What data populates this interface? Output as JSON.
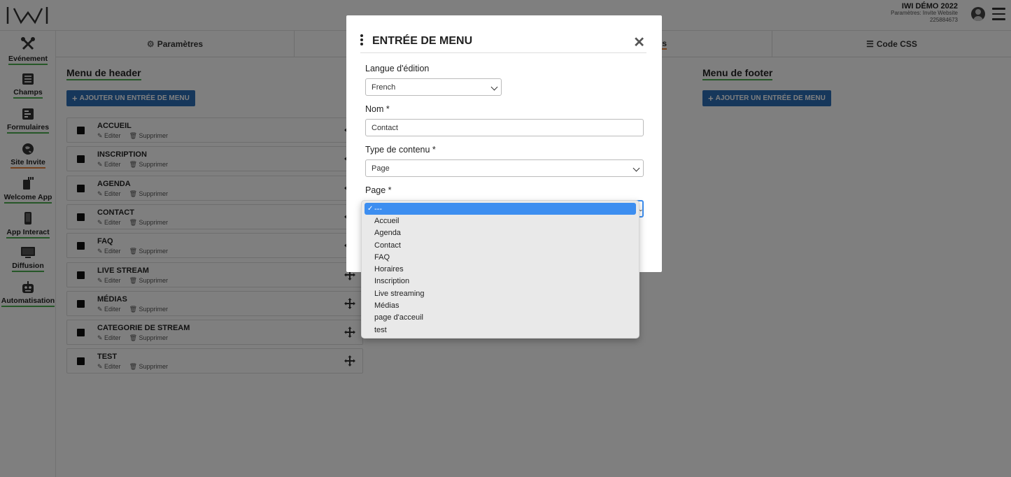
{
  "header": {
    "event_title": "IWI DÉMO 2022",
    "event_subtitle": "Paramètres: Invite Website",
    "event_id": "225884673"
  },
  "sidebar": {
    "items": [
      {
        "label": "Evénement",
        "icon": "tools-icon"
      },
      {
        "label": "Champs",
        "icon": "list-icon"
      },
      {
        "label": "Formulaires",
        "icon": "form-icon"
      },
      {
        "label": "Site Invite",
        "icon": "globe-icon"
      },
      {
        "label": "Welcome App",
        "icon": "qr-phone-icon"
      },
      {
        "label": "App Interact",
        "icon": "phone-icon"
      },
      {
        "label": "Diffusion",
        "icon": "monitor-icon"
      },
      {
        "label": "Automatisation",
        "icon": "robot-icon"
      }
    ]
  },
  "tabs": [
    {
      "label": "Paramètres",
      "icon": "gear-icon"
    },
    {
      "label": "",
      "icon": ""
    },
    {
      "label": "s",
      "icon": ""
    },
    {
      "label": "Code CSS",
      "icon": "css-icon"
    }
  ],
  "header_menu": {
    "title": "Menu de header",
    "add_label": "AJOUTER UN ENTRÉE DE MENU",
    "edit_label": "Editer",
    "delete_label": "Supprimer",
    "items": [
      "ACCUEIL",
      "INSCRIPTION",
      "AGENDA",
      "CONTACT",
      "FAQ",
      "LIVE STREAM",
      "MÉDIAS",
      "CATEGORIE DE STREAM",
      "TEST"
    ]
  },
  "footer_menu": {
    "title": "Menu de footer",
    "add_label": "AJOUTER UN ENTRÉE DE MENU"
  },
  "modal": {
    "title": "ENTRÉE DE MENU",
    "lang_label": "Langue d'édition",
    "lang_value": "French",
    "name_label": "Nom *",
    "name_value": "Contact",
    "type_label": "Type de contenu *",
    "type_value": "Page",
    "page_label": "Page *"
  },
  "dropdown": {
    "selected": "---",
    "options": [
      "Accueil",
      "Agenda",
      "Contact",
      "FAQ",
      "Horaires",
      "Inscription",
      "Live streaming",
      "Médias",
      "page d'acceuil",
      "test"
    ]
  },
  "colors": {
    "accent_blue": "#2d6fb7",
    "underline_green": "#4caf50",
    "underline_orange": "#e8833a",
    "selection_blue": "#3d8ef0"
  }
}
